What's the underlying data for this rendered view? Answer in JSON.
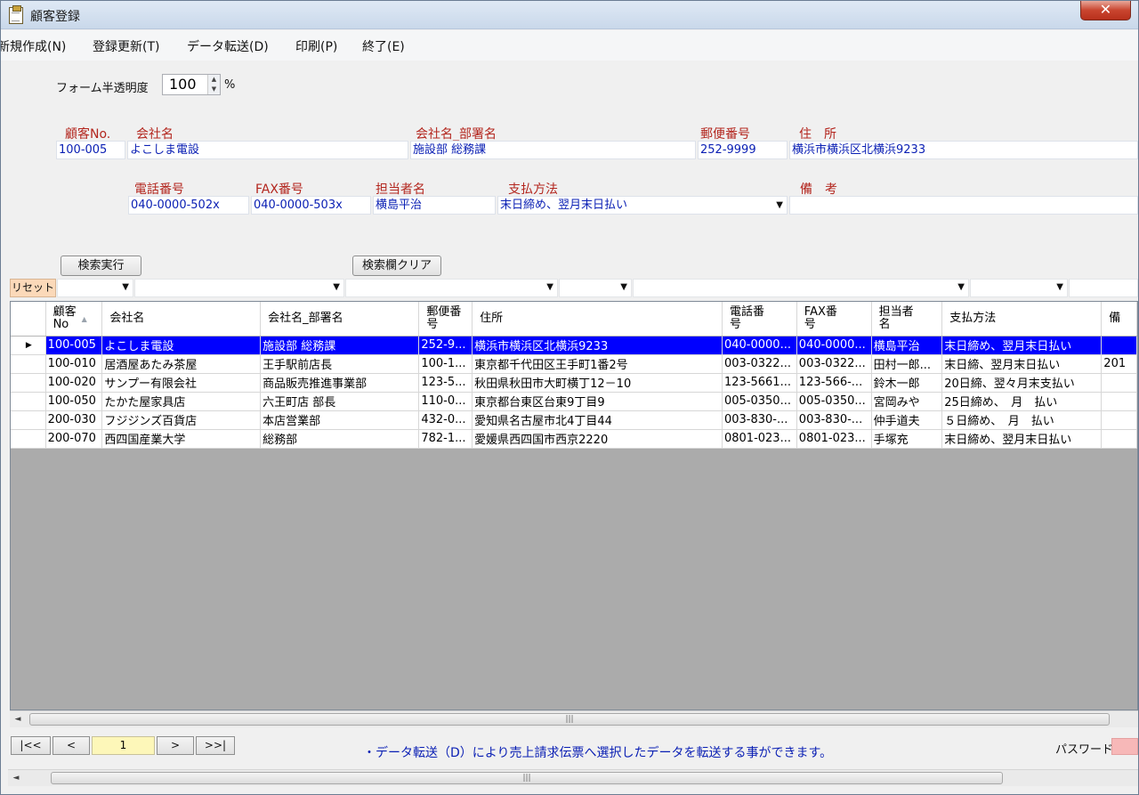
{
  "window": {
    "title": "顧客登録",
    "close_glyph": "✕"
  },
  "menu": [
    "新規作成(N)",
    "登録更新(T)",
    "データ転送(D)",
    "印刷(P)",
    "終了(E)"
  ],
  "opacity": {
    "label": "フォーム半透明度",
    "value": "100",
    "unit": "%"
  },
  "labels": {
    "customer_no": "顧客No.",
    "company": "会社名",
    "department": "会社名_部署名",
    "postal": "郵便番号",
    "address": "住　所",
    "phone": "電話番号",
    "fax": "FAX番号",
    "contact": "担当者名",
    "payment": "支払方法",
    "notes": "備　考"
  },
  "record": {
    "customer_no": "100-005",
    "company": "よこしま電設",
    "department": "施設部 総務課",
    "postal": "252-9999",
    "address": "横浜市横浜区北横浜9233",
    "phone": "040-0000-502x",
    "fax": "040-0000-503x",
    "contact": "横島平治",
    "payment": "末日締め、翌月末日払い",
    "notes": ""
  },
  "buttons": {
    "search": "検索実行",
    "clear": "検索欄クリア",
    "reset": "リセット"
  },
  "grid": {
    "columns": [
      "顧客\nNo",
      "会社名",
      "会社名_部署名",
      "郵便番\n号",
      "住所",
      "電話番\n号",
      "FAX番\n号",
      "担当者\n名",
      "支払方法",
      "備"
    ],
    "rows": [
      [
        "100-005",
        "よこしま電設",
        "施設部 総務課",
        "252-9...",
        "横浜市横浜区北横浜9233",
        "040-0000...",
        "040-0000...",
        "横島平治",
        "末日締め、翌月末日払い",
        ""
      ],
      [
        "100-010",
        "居酒屋あたみ茶屋",
        "王手駅前店長",
        "100-1...",
        "東京都千代田区王手町1番2号",
        "003-0322...",
        "003-0322...",
        "田村一郎...",
        "末日締、翌月末日払い",
        "201"
      ],
      [
        "100-020",
        "サンプー有限会社",
        "商品販売推進事業部",
        "123-5...",
        "秋田県秋田市大町横丁12－10",
        "123-5661...",
        "123-566-...",
        "鈴木一郎",
        "20日締、翌々月末支払い",
        ""
      ],
      [
        "100-050",
        "たかた屋家具店",
        "六王町店 部長",
        "110-0...",
        "東京都台東区台東9丁目9",
        "005-0350...",
        "005-0350...",
        "宮岡みや",
        "25日締め、　月　払い",
        ""
      ],
      [
        "200-030",
        "フジジンズ百貨店",
        "本店営業部",
        "432-0...",
        "愛知県名古屋市北4丁目44",
        "003-830-...",
        "003-830-...",
        "仲手道夫",
        "５日締め、　月　払い",
        ""
      ],
      [
        "200-070",
        "西四国産業大学",
        "総務部",
        "782-1...",
        "愛媛県西四国市西京2220",
        "0801-023...",
        "0801-023...",
        "手塚充",
        "末日締め、翌月末日払い",
        ""
      ]
    ],
    "selected_row": 0
  },
  "pager": {
    "first": "|<<",
    "prev": "<",
    "page": "1",
    "next": ">",
    "last": ">>|"
  },
  "status": {
    "message": "・データ転送（D）により売上請求伝票へ選択したデータを転送する事ができます。",
    "password_label": "パスワード"
  },
  "colors": {
    "label_red": "#b3261e",
    "value_blue": "#0a1fb4",
    "selection": "#0000ff"
  }
}
